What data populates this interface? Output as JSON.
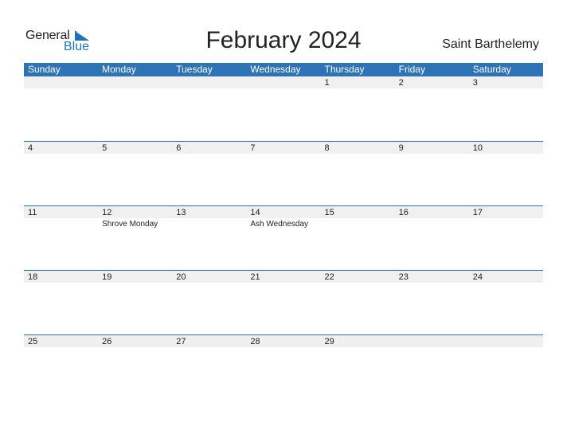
{
  "logo": {
    "general": "General",
    "blue": "Blue",
    "accent": "#1e73be"
  },
  "title": "February 2024",
  "country": "Saint Barthelemy",
  "colors": {
    "header_bg": "#2e73b6",
    "date_band": "#f0f0f0"
  },
  "weekdays": [
    "Sunday",
    "Monday",
    "Tuesday",
    "Wednesday",
    "Thursday",
    "Friday",
    "Saturday"
  ],
  "weeks": [
    {
      "days": [
        {
          "n": "",
          "e": ""
        },
        {
          "n": "",
          "e": ""
        },
        {
          "n": "",
          "e": ""
        },
        {
          "n": "",
          "e": ""
        },
        {
          "n": "1",
          "e": ""
        },
        {
          "n": "2",
          "e": ""
        },
        {
          "n": "3",
          "e": ""
        }
      ]
    },
    {
      "days": [
        {
          "n": "4",
          "e": ""
        },
        {
          "n": "5",
          "e": ""
        },
        {
          "n": "6",
          "e": ""
        },
        {
          "n": "7",
          "e": ""
        },
        {
          "n": "8",
          "e": ""
        },
        {
          "n": "9",
          "e": ""
        },
        {
          "n": "10",
          "e": ""
        }
      ]
    },
    {
      "days": [
        {
          "n": "11",
          "e": ""
        },
        {
          "n": "12",
          "e": "Shrove Monday"
        },
        {
          "n": "13",
          "e": ""
        },
        {
          "n": "14",
          "e": "Ash Wednesday"
        },
        {
          "n": "15",
          "e": ""
        },
        {
          "n": "16",
          "e": ""
        },
        {
          "n": "17",
          "e": ""
        }
      ]
    },
    {
      "days": [
        {
          "n": "18",
          "e": ""
        },
        {
          "n": "19",
          "e": ""
        },
        {
          "n": "20",
          "e": ""
        },
        {
          "n": "21",
          "e": ""
        },
        {
          "n": "22",
          "e": ""
        },
        {
          "n": "23",
          "e": ""
        },
        {
          "n": "24",
          "e": ""
        }
      ]
    },
    {
      "days": [
        {
          "n": "25",
          "e": ""
        },
        {
          "n": "26",
          "e": ""
        },
        {
          "n": "27",
          "e": ""
        },
        {
          "n": "28",
          "e": ""
        },
        {
          "n": "29",
          "e": ""
        },
        {
          "n": "",
          "e": ""
        },
        {
          "n": "",
          "e": ""
        }
      ]
    }
  ]
}
